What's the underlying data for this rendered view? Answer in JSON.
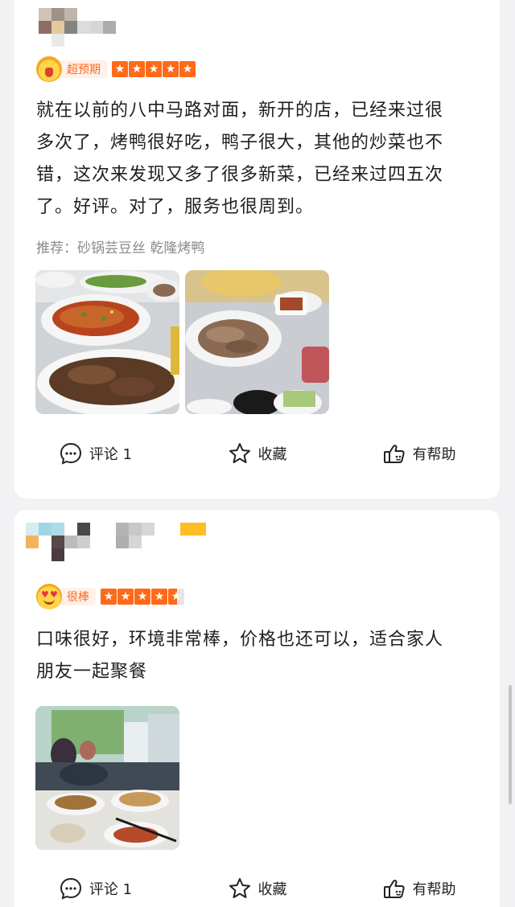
{
  "reviews": [
    {
      "badge": "超预期",
      "stars": 5,
      "text_lines": [
        "就在以前的八中马路对面，新开的店，已经来过很",
        "多次了，烤鸭很好吃，鸭子很大，其他的炒菜也不",
        "错，这次来发现又多了很多新菜，已经来过四五次",
        "了。好评。对了，服务也很周到。"
      ],
      "recommend_label": "推荐：",
      "recommend_items": "砂锅芸豆丝  乾隆烤鸭",
      "actions": {
        "comment": "评论 1",
        "favorite": "收藏",
        "helpful": "有帮助"
      }
    },
    {
      "badge": "很棒",
      "stars": 4.5,
      "text_lines": [
        "口味很好，环境非常棒，价格也还可以，适合家人",
        "朋友一起聚餐"
      ],
      "actions": {
        "comment": "评论 1",
        "favorite": "收藏",
        "helpful": "有帮助"
      }
    }
  ],
  "colors": {
    "accent": "#ff6a1a",
    "badge_bg": "#fff0e8",
    "page_bg": "#f2f2f4"
  },
  "icons": [
    "chat-bubble-icon",
    "star-outline-icon",
    "thumbs-up-hand-icon",
    "crown-emoji-icon",
    "heart-eyes-emoji-icon"
  ]
}
